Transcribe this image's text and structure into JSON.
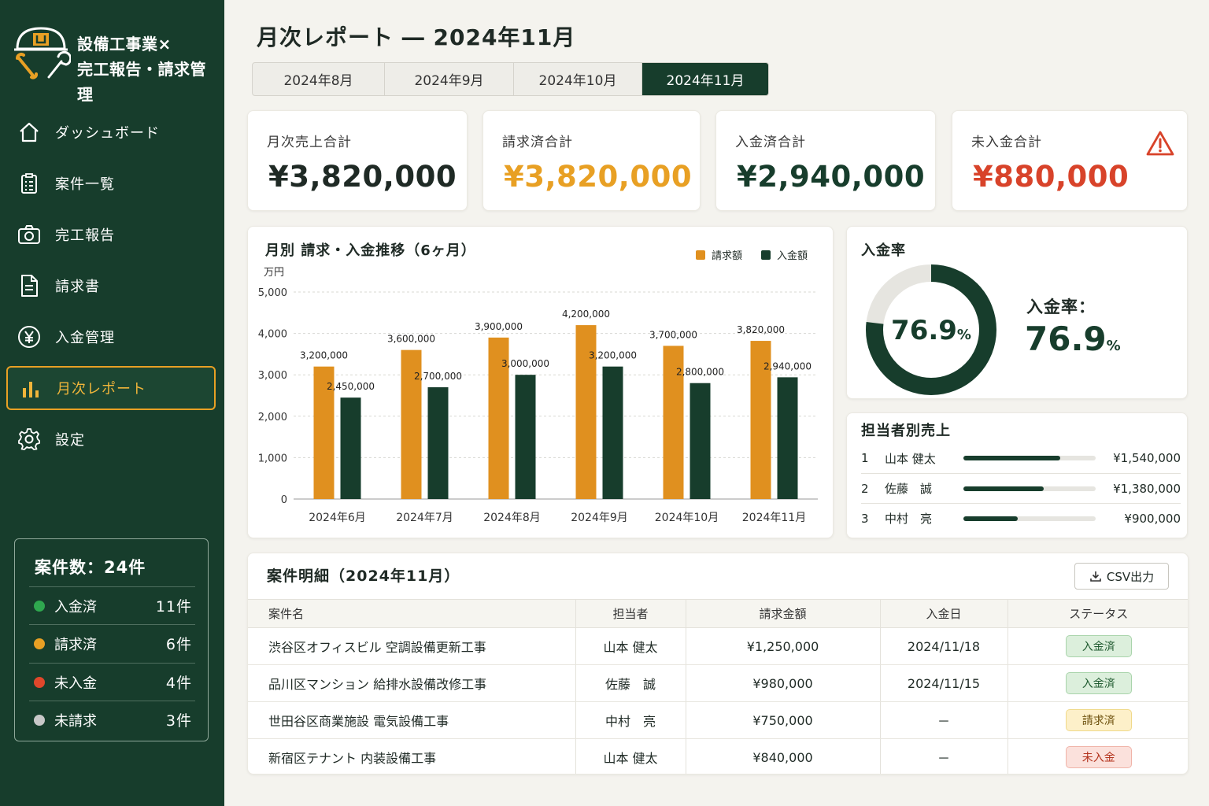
{
  "sidebar": {
    "brand_line1": "設備工事業×",
    "brand_line2": "完工報告・請求管理",
    "nav": [
      {
        "label": "ダッシュボード",
        "icon": "home-icon"
      },
      {
        "label": "案件一覧",
        "icon": "clipboard-icon"
      },
      {
        "label": "完工報告",
        "icon": "camera-icon"
      },
      {
        "label": "請求書",
        "icon": "document-icon"
      },
      {
        "label": "入金管理",
        "icon": "yen-icon"
      },
      {
        "label": "月次レポート",
        "icon": "bar-chart-icon",
        "active": true
      },
      {
        "label": "設定",
        "icon": "gear-icon"
      }
    ],
    "count_title": "案件数：24件",
    "counts": [
      {
        "name": "入金済",
        "value": "11件",
        "color": "#2fa84f"
      },
      {
        "name": "請求済",
        "value": "6件",
        "color": "#e8a024"
      },
      {
        "name": "未入金",
        "value": "4件",
        "color": "#e0472b"
      },
      {
        "name": "未請求",
        "value": "3件",
        "color": "#c8c8c8"
      }
    ]
  },
  "header": {
    "title": "月次レポート ― 2024年11月",
    "tabs": [
      "2024年8月",
      "2024年9月",
      "2024年10月",
      "2024年11月"
    ],
    "active_tab": 3
  },
  "kpis": [
    {
      "label": "月次売上合計",
      "value": "¥3,820,000",
      "color": "#1f2a25"
    },
    {
      "label": "請求済合計",
      "value": "¥3,820,000",
      "color": "#e8a024"
    },
    {
      "label": "入金済合計",
      "value": "¥2,940,000",
      "color": "#173d2c"
    },
    {
      "label": "未入金合計",
      "value": "¥880,000",
      "color": "#d8432a"
    }
  ],
  "chart_data": {
    "type": "bar",
    "title": "月別 請求・入金推移（6ヶ月）",
    "ylabel": "万円",
    "ylim": [
      0,
      5000
    ],
    "yticks": [
      "0",
      "1,000",
      "2,000",
      "3,000",
      "4,000",
      "5,000"
    ],
    "categories": [
      "2024年6月",
      "2024年7月",
      "2024年8月",
      "2024年9月",
      "2024年10月",
      "2024年11月"
    ],
    "series": [
      {
        "name": "請求額",
        "color": "#e0901f",
        "values": [
          3200000,
          3600000,
          3900000,
          4200000,
          3700000,
          3820000
        ],
        "labels": [
          "3,200,000",
          "3,600,000",
          "3,900,000",
          "4,200,000",
          "3,700,000",
          "3,820,000"
        ]
      },
      {
        "name": "入金額",
        "color": "#173d2c",
        "values": [
          2450000,
          2700000,
          3000000,
          3200000,
          2800000,
          2940000
        ],
        "labels": [
          "2,450,000",
          "2,700,000",
          "3,000,000",
          "3,200,000",
          "2,800,000",
          "2,940,000"
        ]
      }
    ],
    "grid": true,
    "legend": "top-right"
  },
  "rate": {
    "title": "入金率",
    "value": 76.9,
    "value_text": "76.9",
    "unit": "%",
    "label": "入金率："
  },
  "staff": {
    "title": "担当者別売上",
    "rows": [
      {
        "rank": "1",
        "name": "山本 健太",
        "amount": "¥1,540,000",
        "ratio": 0.73
      },
      {
        "rank": "2",
        "name": "佐藤　誠",
        "amount": "¥1,380,000",
        "ratio": 0.61
      },
      {
        "rank": "3",
        "name": "中村　亮",
        "amount": "¥900,000",
        "ratio": 0.41
      }
    ]
  },
  "table": {
    "title": "案件明細（2024年11月）",
    "csv_label": "CSV出力",
    "headers": [
      "案件名",
      "担当者",
      "請求金額",
      "入金日",
      "ステータス"
    ],
    "rows": [
      {
        "name": "渋谷区オフィスビル 空調設備更新工事",
        "staff": "山本 健太",
        "amount": "¥1,250,000",
        "date": "2024/11/18",
        "status": "入金済",
        "status_kind": "paid"
      },
      {
        "name": "品川区マンション 給排水設備改修工事",
        "staff": "佐藤　誠",
        "amount": "¥980,000",
        "date": "2024/11/15",
        "status": "入金済",
        "status_kind": "paid"
      },
      {
        "name": "世田谷区商業施設 電気設備工事",
        "staff": "中村　亮",
        "amount": "¥750,000",
        "date": "－",
        "status": "請求済",
        "status_kind": "billed"
      },
      {
        "name": "新宿区テナント 内装設備工事",
        "staff": "山本 健太",
        "amount": "¥840,000",
        "date": "－",
        "status": "未入金",
        "status_kind": "unpaid"
      }
    ],
    "status_colors": {
      "paid": {
        "bg": "#dcefdc",
        "border": "#a9d4ab",
        "text": "#1f5a2f"
      },
      "billed": {
        "bg": "#fdf0c9",
        "border": "#f0d98a",
        "text": "#6b4e0a"
      },
      "unpaid": {
        "bg": "#fbe1dc",
        "border": "#f0b3a8",
        "text": "#b3321c"
      }
    }
  }
}
